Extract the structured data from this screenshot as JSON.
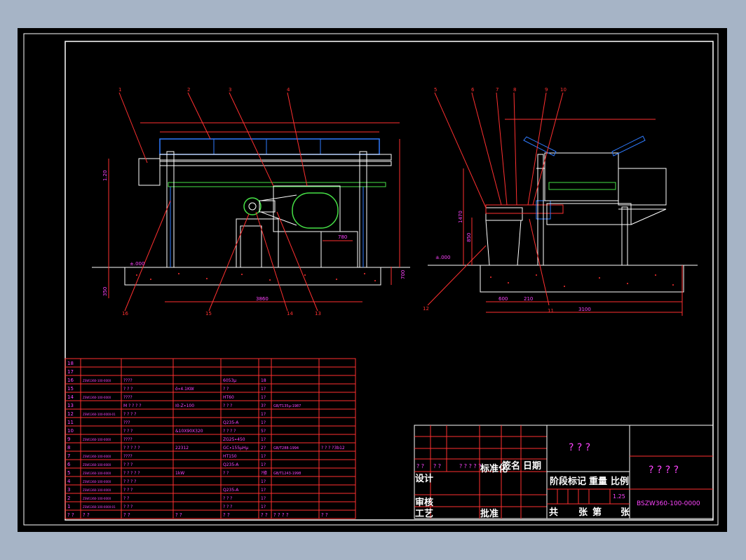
{
  "drawing": {
    "part_labels": [
      "1",
      "2",
      "3",
      "4",
      "5",
      "6",
      "7",
      "8",
      "9",
      "10",
      "11",
      "12",
      "13",
      "14",
      "15",
      "16"
    ],
    "dims_front": {
      "width": "3860",
      "height": "780",
      "left_h": "1.20",
      "foundation": "350",
      "right_h": "700",
      "ground": "±.000"
    },
    "dims_side": {
      "a": "600",
      "b": "210",
      "c": "3100",
      "h1": "850",
      "h2": "1470",
      "ground": "±.000"
    }
  },
  "bom": {
    "rows": [
      {
        "no": "18",
        "code": "",
        "name": "",
        "spec": "",
        "mat": "",
        "qty": "",
        "std": "",
        "note": ""
      },
      {
        "no": "17",
        "code": "",
        "name": "",
        "spec": "",
        "mat": "",
        "qty": "",
        "std": "",
        "note": ""
      },
      {
        "no": "16",
        "code": "ZSW1360-100-0000",
        "name": "????",
        "spec": "",
        "mat": "6053µ",
        "qty": "18",
        "std": "",
        "note": ""
      },
      {
        "no": "15",
        "code": "",
        "name": "? ? ?",
        "spec": "ö∙4.1KW",
        "mat": "? ?",
        "qty": "1?",
        "std": "",
        "note": ""
      },
      {
        "no": "14",
        "code": "ZSW1360-100-0000",
        "name": "????",
        "spec": "",
        "mat": "HT60",
        "qty": "1?",
        "std": "",
        "note": ""
      },
      {
        "no": "13",
        "code": "",
        "name": "M ? ? ? ?",
        "spec": "I0-Z∙100",
        "mat": "? ? ?",
        "qty": "3?",
        "std": "GB/T135µ-1987",
        "note": ""
      },
      {
        "no": "12",
        "code": "ZSW1360-100-0000-01",
        "name": "? ? ? ?",
        "spec": "",
        "mat": "",
        "qty": "1?",
        "std": "",
        "note": ""
      },
      {
        "no": "11",
        "code": "",
        "name": "???",
        "spec": "",
        "mat": "Q235-A",
        "qty": "1?",
        "std": "",
        "note": ""
      },
      {
        "no": "10",
        "code": "",
        "name": "? ? ?",
        "spec": "&10X90X320",
        "mat": "? ? ? ?",
        "qty": "5?",
        "std": "",
        "note": ""
      },
      {
        "no": "9",
        "code": "ZSW1360-100-0000",
        "name": "????",
        "spec": "",
        "mat": "ZG25∙450",
        "qty": "1?",
        "std": "",
        "note": ""
      },
      {
        "no": "8",
        "code": "",
        "name": "? ? ? ? ?",
        "spec": "22312",
        "mat": "GC∙155µHµ",
        "qty": "2?",
        "std": "GB/T288-1994",
        "note": "? ? ? ?3b12"
      },
      {
        "no": "7",
        "code": "ZSW1360-100-0000",
        "name": "????",
        "spec": "",
        "mat": "HT150",
        "qty": "1?",
        "std": "",
        "note": ""
      },
      {
        "no": "6",
        "code": "ZSW1360-100-0000",
        "name": "? ? ?",
        "spec": "",
        "mat": "Q235-A",
        "qty": "1?",
        "std": "",
        "note": ""
      },
      {
        "no": "5",
        "code": "ZSW1360-100-0000",
        "name": "? ? ? ? ?",
        "spec": "1kW",
        "mat": "? ?",
        "qty": "?修",
        "std": "GB/T1243-1998",
        "note": ""
      },
      {
        "no": "4",
        "code": "ZSW1360-100-0000",
        "name": "? ? ? ?",
        "spec": "",
        "mat": "",
        "qty": "1?",
        "std": "",
        "note": ""
      },
      {
        "no": "3",
        "code": "ZSW1360-100-0000",
        "name": "? ? ?",
        "spec": "",
        "mat": "Q235-A",
        "qty": "1?",
        "std": "",
        "note": ""
      },
      {
        "no": "2",
        "code": "ZSW1360-100-0000",
        "name": "? ?",
        "spec": "",
        "mat": "? ? ?",
        "qty": "1?",
        "std": "",
        "note": ""
      },
      {
        "no": "1",
        "code": "ZSW1360-100-0000-01",
        "name": "? ? ?",
        "spec": "",
        "mat": "? ? ?",
        "qty": "1?",
        "std": "",
        "note": ""
      }
    ],
    "header": {
      "no": "? ?",
      "code": "? ?",
      "name": "?   ?",
      "spec": "?   ?",
      "mat": "?  ?",
      "qty": "? ?",
      "std": "? ? ? ?",
      "note": "?  ?"
    }
  },
  "title_block": {
    "project": "? ? ?",
    "drawing_name": "? ? ? ?",
    "drawing_no": "BSZW360-100-0000",
    "scale_value": "1.25",
    "row_marks": [
      "? ?",
      "? ?",
      "? ? ? ? ?"
    ],
    "lbl_std": "标准化",
    "lbl_sign": "签名",
    "lbl_date": "日期",
    "lbl_design": "设计",
    "lbl_review": "审核",
    "lbl_process": "工艺",
    "lbl_approve": "批准",
    "lbl_stage": "阶段标记",
    "lbl_weight": "重量",
    "lbl_ratio": "比例",
    "lbl_total": "共",
    "lbl_sheet": "张",
    "lbl_no": "第",
    "lbl_sheet2": "张"
  },
  "colors": {
    "background": "#a6b4c6",
    "sheet": "#000000",
    "line": "#ffffff",
    "dim": "#ff3030",
    "text": "#ff44ff",
    "part": "#2f7bff",
    "green": "#46e046"
  }
}
